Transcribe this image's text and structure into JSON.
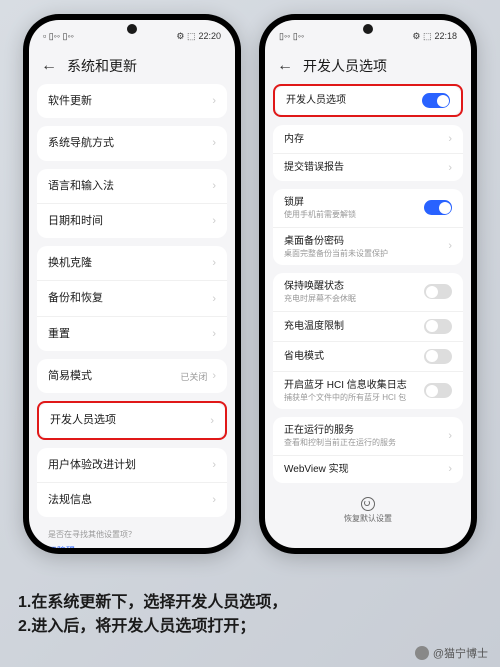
{
  "left": {
    "time": "22:20",
    "title": "系统和更新",
    "rows": [
      {
        "label": "软件更新"
      },
      {
        "label": "系统导航方式"
      },
      {
        "label": "语言和输入法"
      },
      {
        "label": "日期和时间"
      },
      {
        "label": "换机克隆"
      },
      {
        "label": "备份和恢复"
      },
      {
        "label": "重置"
      },
      {
        "label": "简易模式",
        "value": "已关闭"
      },
      {
        "label": "开发人员选项",
        "highlight": true
      },
      {
        "label": "用户体验改进计划"
      },
      {
        "label": "法规信息"
      }
    ],
    "hint": "是否在寻找其他设置项？",
    "link": "无障碍"
  },
  "right": {
    "time": "22:18",
    "title": "开发人员选项",
    "rows": [
      {
        "label": "开发人员选项",
        "toggle": true,
        "on": true,
        "highlight": true
      },
      {
        "label": "内存"
      },
      {
        "label": "提交错误报告"
      },
      {
        "label": "锁屏",
        "sub": "使用手机前需要解锁",
        "toggle": true,
        "on": true
      },
      {
        "label": "桌面备份密码",
        "sub": "桌面完整备份当前未设置保护"
      },
      {
        "label": "保持唤醒状态",
        "sub": "充电时屏幕不会休眠",
        "toggle": true,
        "on": false
      },
      {
        "label": "充电温度限制",
        "toggle": true,
        "on": false
      },
      {
        "label": "省电模式",
        "toggle": true,
        "on": false
      },
      {
        "label": "开启蓝牙 HCI 信息收集日志",
        "sub": "捕获单个文件中的所有蓝牙 HCI 包",
        "toggle": true,
        "on": false
      },
      {
        "label": "正在运行的服务",
        "sub": "查看和控制当前正在运行的服务"
      },
      {
        "label": "WebView 实现"
      }
    ],
    "bottom": "恢复默认设置"
  },
  "instructions": {
    "line1": "1.在系统更新下，选择开发人员选项，",
    "line2": "2.进入后，将开发人员选项打开；"
  },
  "watermark": "@猫宁博士"
}
